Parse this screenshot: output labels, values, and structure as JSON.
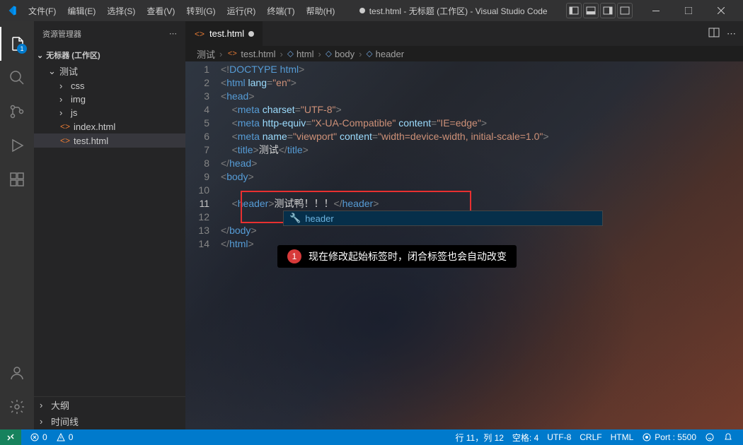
{
  "title": {
    "file": "test.html",
    "workspace": "无标题 (工作区)",
    "app": "Visual Studio Code"
  },
  "menu": [
    "文件(F)",
    "编辑(E)",
    "选择(S)",
    "查看(V)",
    "转到(G)",
    "运行(R)",
    "终端(T)",
    "帮助(H)"
  ],
  "sidebar": {
    "header": "资源管理器",
    "workspace": "无标器 (工作区)",
    "root": "测试",
    "folders": [
      "css",
      "img",
      "js"
    ],
    "files": [
      "index.html",
      "test.html"
    ],
    "outline": "大纲",
    "timeline": "时间线"
  },
  "tabs": {
    "active": "test.html"
  },
  "breadcrumb": [
    "测试",
    "test.html",
    "html",
    "body",
    "header"
  ],
  "code": {
    "l1": {
      "a": "<!",
      "b": "DOCTYPE",
      "c": " html",
      "d": ">"
    },
    "l2": {
      "a": "<",
      "b": "html",
      "c": " lang",
      "d": "=",
      "e": "\"en\"",
      "f": ">"
    },
    "l3": {
      "a": "<",
      "b": "head",
      "c": ">"
    },
    "l4": {
      "a": "<",
      "b": "meta",
      "c": " charset",
      "d": "=",
      "e": "\"UTF-8\"",
      "f": ">"
    },
    "l5": {
      "a": "<",
      "b": "meta",
      "c": " http-equiv",
      "d": "=",
      "e": "\"X-UA-Compatible\"",
      "f": " content",
      "g": "=",
      "h": "\"IE=edge\"",
      "i": ">"
    },
    "l6": {
      "a": "<",
      "b": "meta",
      "c": " name",
      "d": "=",
      "e": "\"viewport\"",
      "f": " content",
      "g": "=",
      "h": "\"width=device-width, initial-scale=1.0\"",
      "i": ">"
    },
    "l7": {
      "a": "<",
      "b": "title",
      "c": ">",
      "d": "测试",
      "e": "</",
      "f": "title",
      "g": ">"
    },
    "l8": {
      "a": "</",
      "b": "head",
      "c": ">"
    },
    "l9": {
      "a": "<",
      "b": "body",
      "c": ">"
    },
    "l11": {
      "a": "<",
      "b": "header",
      "c": ">",
      "d": "测试鸭！！！",
      "e": "</",
      "f": "header",
      "g": ">"
    },
    "l13": {
      "a": "</",
      "b": "body",
      "c": ">"
    },
    "l14": {
      "a": "</",
      "b": "html",
      "c": ">"
    }
  },
  "suggest": {
    "item": "header"
  },
  "callout": {
    "num": "1",
    "text": "现在修改起始标签时，闭合标签也会自动改变"
  },
  "status": {
    "errors": "0",
    "warnings": "0",
    "port": "Port : 5500",
    "cursor": "行 11，列 12",
    "spaces": "空格: 4",
    "encoding": "UTF-8",
    "eol": "CRLF",
    "lang": "HTML"
  },
  "badge": {
    "explorer": "1"
  }
}
